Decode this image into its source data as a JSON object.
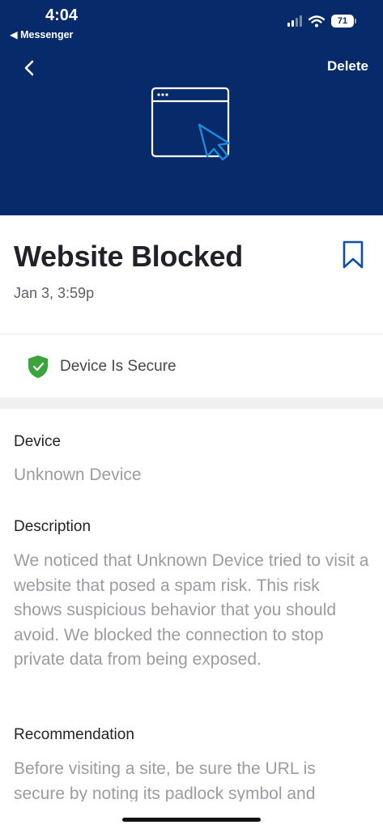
{
  "status_bar": {
    "time": "4:04",
    "back_app": "◀ Messenger",
    "battery": "71"
  },
  "header": {
    "delete_label": "Delete",
    "icons": [
      "chevron-left-icon",
      "browser-window-icon",
      "cursor-arrow-icon"
    ]
  },
  "alert": {
    "title": "Website Blocked",
    "timestamp": "Jan 3, 3:59p",
    "bookmark_icon": "bookmark-icon"
  },
  "status": {
    "label": "Device Is Secure",
    "color": "#3aa53c"
  },
  "sections": {
    "device": {
      "heading": "Device",
      "value": "Unknown Device"
    },
    "description": {
      "heading": "Description",
      "body": "We noticed that Unknown Device tried to visit a website that posed a spam risk. This risk shows suspicious behavior that you should avoid. We blocked the connection to stop private data from being exposed."
    },
    "recommendation": {
      "heading": "Recommendation",
      "body": "Before visiting a site, be sure the URL is secure by noting its padlock symbol and"
    }
  },
  "colors": {
    "header_bg": "#062a6a",
    "accent": "#1f8ce0",
    "bookmark": "#0e4fa8"
  }
}
